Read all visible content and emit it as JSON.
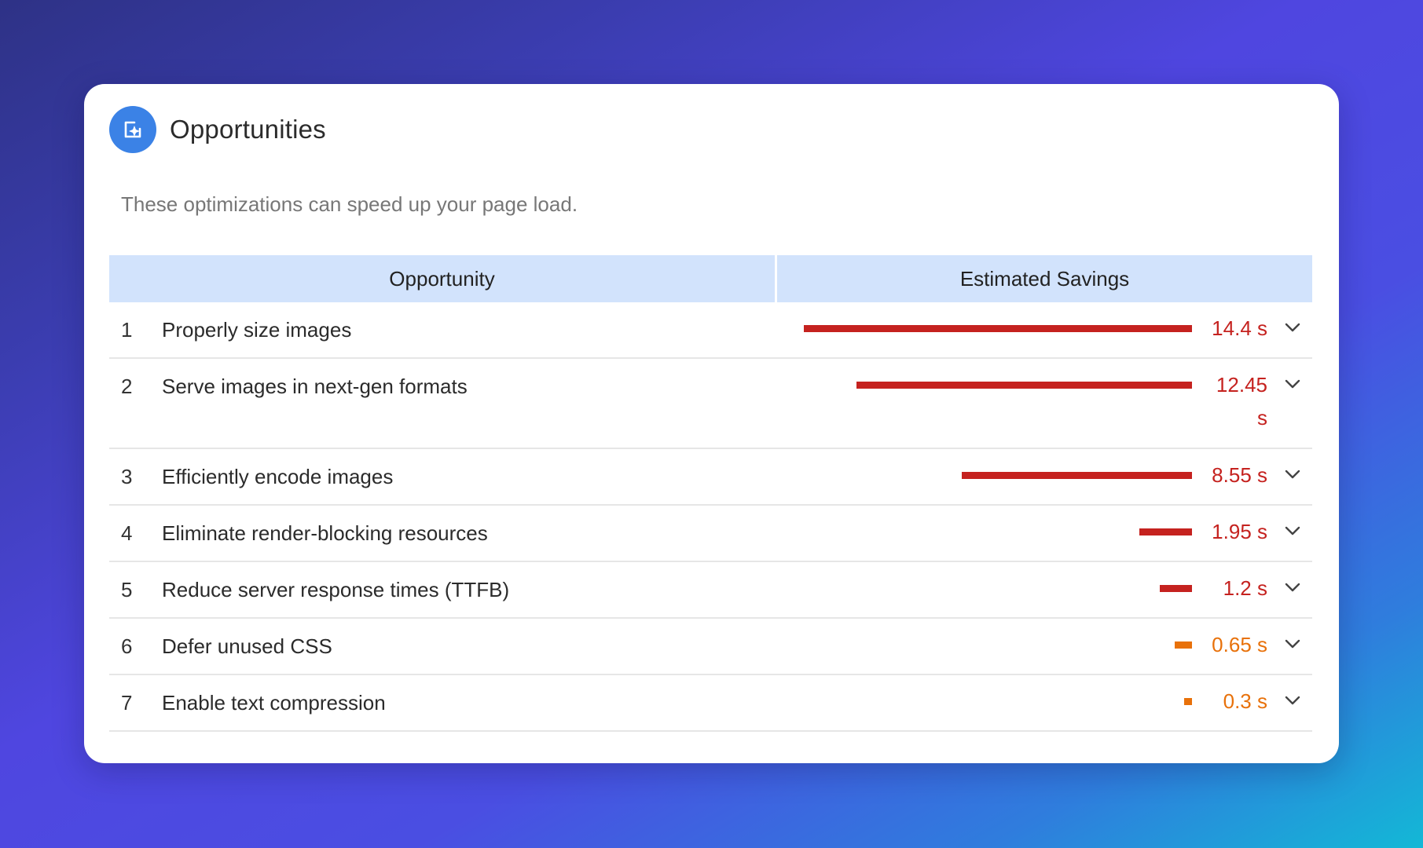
{
  "header": {
    "title": "Opportunities",
    "subtitle": "These optimizations can speed up your page load.",
    "logo_icon": "page-sparkle-icon",
    "logo_color": "#3b82e6"
  },
  "table": {
    "columns": [
      "Opportunity",
      "Estimated Savings"
    ],
    "header_color": "#d2e3fc",
    "rows": [
      {
        "index": "1",
        "label": "Properly size images",
        "savings": "14.4 s",
        "bar_fraction": 1.0,
        "severity": "fail",
        "color": "#c5221f"
      },
      {
        "index": "2",
        "label": "Serve images in next-gen formats",
        "savings": "12.45 s",
        "bar_fraction": 0.865,
        "severity": "fail",
        "color": "#c5221f"
      },
      {
        "index": "3",
        "label": "Efficiently encode images",
        "savings": "8.55 s",
        "bar_fraction": 0.594,
        "severity": "fail",
        "color": "#c5221f"
      },
      {
        "index": "4",
        "label": "Eliminate render-blocking resources",
        "savings": "1.95 s",
        "bar_fraction": 0.135,
        "severity": "fail",
        "color": "#c5221f"
      },
      {
        "index": "5",
        "label": "Reduce server response times (TTFB)",
        "savings": "1.2 s",
        "bar_fraction": 0.083,
        "severity": "fail",
        "color": "#c5221f"
      },
      {
        "index": "6",
        "label": "Defer unused CSS",
        "savings": "0.65 s",
        "bar_fraction": 0.045,
        "severity": "average",
        "color": "#e8710a"
      },
      {
        "index": "7",
        "label": "Enable text compression",
        "savings": "0.3 s",
        "bar_fraction": 0.021,
        "severity": "average",
        "color": "#e8710a"
      }
    ],
    "expand_icon": "chevron-down-icon"
  }
}
